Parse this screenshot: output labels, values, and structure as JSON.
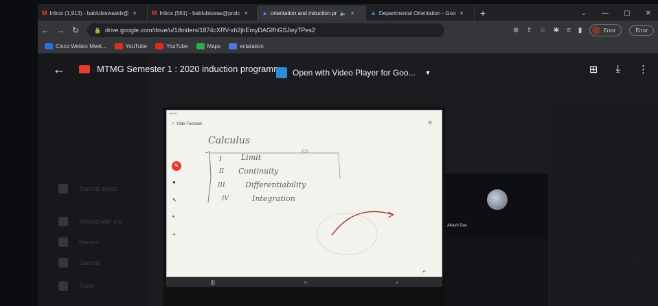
{
  "browser": {
    "tabs": [
      {
        "icon": "M",
        "label": "Inbox (1,913) - bablubiswaskb@",
        "active": false,
        "color": "#ea4335"
      },
      {
        "icon": "M",
        "label": "Inbox (561) - bablubiswas@pndc",
        "active": false,
        "color": "#ea4335"
      },
      {
        "icon": "drive",
        "label": "orientation and induction pr",
        "active": true,
        "color": "#4285f4"
      },
      {
        "icon": "drive",
        "label": "Departmental Orientation - Goo",
        "active": false,
        "color": "#4285f4"
      }
    ],
    "new_tab": "+",
    "url": "drive.google.com/drive/u/1/folders/1874cXRV-xh2jbEmyDAGlfhGSJwyTPes2",
    "profile_error": "Error",
    "profile_error2": "Error",
    "bookmarks": [
      {
        "label": "Cisco Webex Meet...",
        "color": "#2b73d9"
      },
      {
        "label": "YouTube",
        "color": "#e02b20"
      },
      {
        "label": "YouTube",
        "color": "#e02b20"
      },
      {
        "label": "Maps",
        "color": "#34a853"
      },
      {
        "label": "eclaration",
        "color": "#4a7bd8"
      }
    ]
  },
  "preview": {
    "file_title": "MTMG Semester 1 : 2020 induction programme",
    "open_with": "Open with Video Player for Goo...",
    "icons": [
      "back-arrow-icon",
      "add-to-drive-icon",
      "download-icon",
      "more-vert-icon"
    ]
  },
  "sidebar_faded": [
    "Starred drives",
    "Shared with me",
    "Recent",
    "Starred",
    "Trash"
  ],
  "video": {
    "toolbar_label": "Hide Function",
    "whiteboard_text": {
      "heading": "Calculus",
      "items": [
        {
          "num": "I",
          "text": "Limit"
        },
        {
          "num": "II",
          "text": "Continuity"
        },
        {
          "num": "III",
          "text": "Differentiability"
        },
        {
          "num": "IV",
          "text": "Integration"
        }
      ]
    },
    "participant_name": "Akash Das"
  }
}
